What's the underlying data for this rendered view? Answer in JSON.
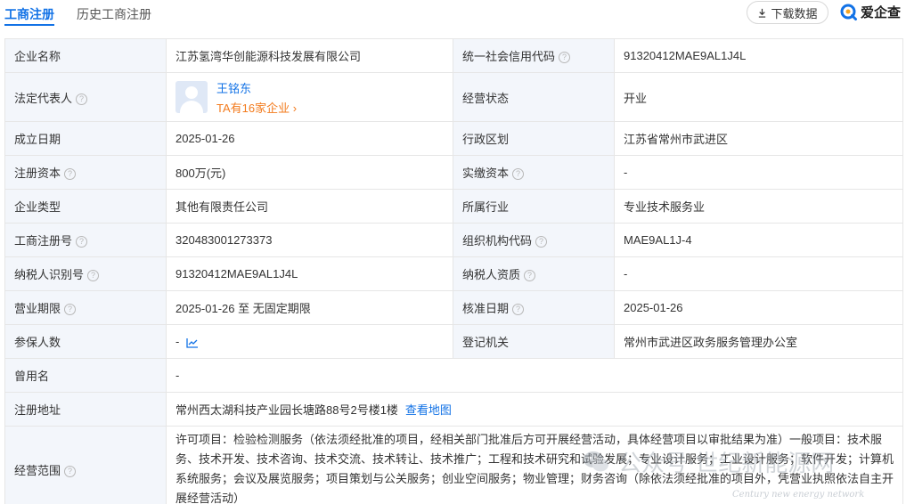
{
  "tabs": {
    "active": "工商注册",
    "history": "历史工商注册"
  },
  "toolbar": {
    "download_label": "下载数据"
  },
  "brand": {
    "name": "爱企查",
    "accent": "#1272e6"
  },
  "rows": {
    "company_name": {
      "label": "企业名称",
      "value": "江苏氢湾华创能源科技发展有限公司"
    },
    "credit_code": {
      "label": "统一社会信用代码",
      "value": "91320412MAE9AL1J4L"
    },
    "legal_rep": {
      "label": "法定代表人",
      "name": "王铭东",
      "count": "TA有16家企业 ›"
    },
    "status": {
      "label": "经营状态",
      "value": "开业"
    },
    "founded": {
      "label": "成立日期",
      "value": "2025-01-26"
    },
    "region": {
      "label": "行政区划",
      "value": "江苏省常州市武进区"
    },
    "capital": {
      "label": "注册资本",
      "value": "800万(元)"
    },
    "paid_capital": {
      "label": "实缴资本",
      "value": "-"
    },
    "company_type": {
      "label": "企业类型",
      "value": "其他有限责任公司"
    },
    "industry": {
      "label": "所属行业",
      "value": "专业技术服务业"
    },
    "reg_no": {
      "label": "工商注册号",
      "value": "320483001273373"
    },
    "org_code": {
      "label": "组织机构代码",
      "value": "MAE9AL1J-4"
    },
    "taxpayer_id": {
      "label": "纳税人识别号",
      "value": "91320412MAE9AL1J4L"
    },
    "taxpayer_qual": {
      "label": "纳税人资质",
      "value": "-"
    },
    "term": {
      "label": "营业期限",
      "value": "2025-01-26 至 无固定期限"
    },
    "approval_date": {
      "label": "核准日期",
      "value": "2025-01-26"
    },
    "insured": {
      "label": "参保人数",
      "value": "-"
    },
    "authority": {
      "label": "登记机关",
      "value": "常州市武进区政务服务管理办公室"
    },
    "former_name": {
      "label": "曾用名",
      "value": "-"
    },
    "address": {
      "label": "注册地址",
      "value": "常州西太湖科技产业园长塘路88号2号楼1楼",
      "map_link": "查看地图"
    },
    "scope": {
      "label": "经营范围",
      "value": "许可项目：检验检测服务（依法须经批准的项目，经相关部门批准后方可开展经营活动，具体经营项目以审批结果为准）一般项目：技术服务、技术开发、技术咨询、技术交流、技术转让、技术推广；工程和技术研究和试验发展；专业设计服务；工业设计服务；软件开发；计算机系统服务；会议及展览服务；项目策划与公关服务；创业空间服务；物业管理；财务咨询（除依法须经批准的项目外，凭营业执照依法自主开展经营活动）"
    }
  },
  "help_glyph": "?",
  "watermark": {
    "text": "公众号·世纪新能源网",
    "sub": "Century new energy network"
  }
}
